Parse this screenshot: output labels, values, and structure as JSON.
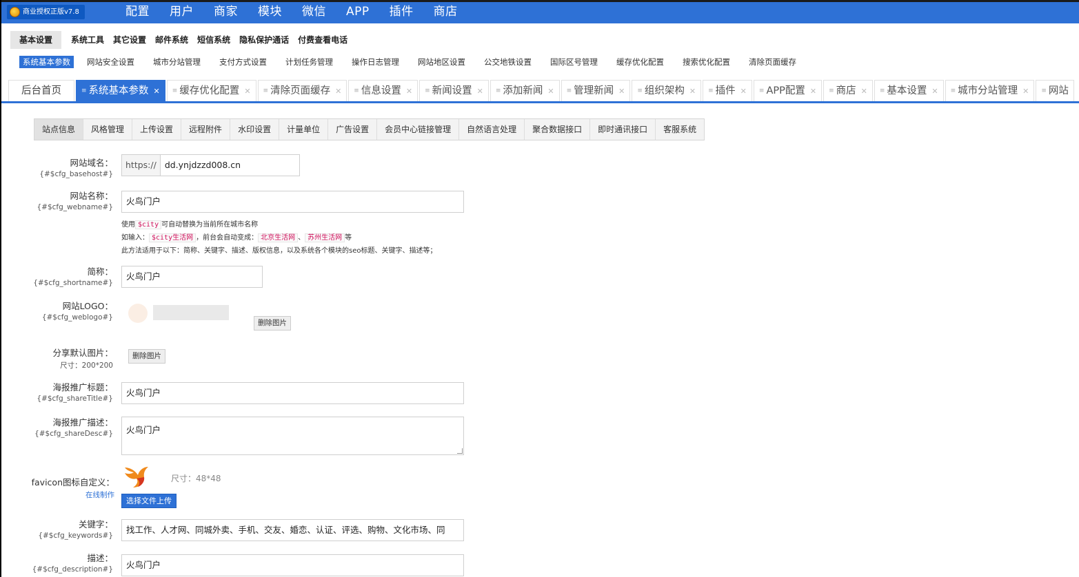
{
  "brand": {
    "label": "商业授权正版v7.8"
  },
  "topnav": [
    "配置",
    "用户",
    "商家",
    "模块",
    "微信",
    "APP",
    "插件",
    "商店"
  ],
  "menu2": [
    "基本设置",
    "系统工具",
    "其它设置",
    "邮件系统",
    "短信系统",
    "隐私保护通话",
    "付费查看电话"
  ],
  "menu3": [
    "系统基本参数",
    "网站安全设置",
    "城市分站管理",
    "支付方式设置",
    "计划任务管理",
    "操作日志管理",
    "网站地区设置",
    "公交地铁设置",
    "国际区号管理",
    "缓存优化配置",
    "搜索优化配置",
    "清除页面缓存"
  ],
  "tabs": {
    "home": "后台首页",
    "items": [
      "系统基本参数",
      "缓存优化配置",
      "清除页面缓存",
      "信息设置",
      "新闻设置",
      "添加新闻",
      "管理新闻",
      "组织架构",
      "插件",
      "APP配置",
      "商店",
      "基本设置",
      "城市分站管理",
      "网站"
    ]
  },
  "innertabs": [
    "站点信息",
    "风格管理",
    "上传设置",
    "远程附件",
    "水印设置",
    "计量单位",
    "广告设置",
    "会员中心链接管理",
    "自然语言处理",
    "聚合数据接口",
    "即时通讯接口",
    "客服系统"
  ],
  "form": {
    "domain": {
      "label": "网站域名：",
      "var": "{#$cfg_basehost#}",
      "prefix": "https://",
      "value": "dd.ynjdzzd008.cn"
    },
    "webname": {
      "label": "网站名称：",
      "var": "{#$cfg_webname#}",
      "value": "火鸟门户"
    },
    "hint": {
      "l1_a": "使用",
      "l1_code": "$city",
      "l1_b": "可自动替换为当前所在城市名称",
      "l2_a": "如输入：",
      "l2_code1": "$city生活网",
      "l2_b": "，前台会自动变成：",
      "l2_code2": "北京生活网",
      "l2_c": "、",
      "l2_code3": "苏州生活网",
      "l2_d": "等",
      "l3": "此方法适用于以下：简称、关键字、描述、版权信息，以及系统各个模块的seo标题、关键字、描述等；"
    },
    "shortname": {
      "label": "简称：",
      "var": "{#$cfg_shortname#}",
      "value": "火鸟门户"
    },
    "weblogo": {
      "label": "网站LOGO：",
      "var": "{#$cfg_weblogo#}",
      "delete": "删除图片"
    },
    "share": {
      "label": "分享默认图片：",
      "sub": "尺寸：200*200",
      "delete": "删除图片"
    },
    "shareTitle": {
      "label": "海报推广标题：",
      "var": "{#$cfg_shareTitle#}",
      "value": "火鸟门户"
    },
    "shareDesc": {
      "label": "海报推广描述：",
      "var": "{#$cfg_shareDesc#}",
      "value": "火鸟门户"
    },
    "favicon": {
      "label": "favicon图标自定义：",
      "link": "在线制作",
      "size": "尺寸：48*48",
      "upload": "选择文件上传"
    },
    "keywords": {
      "label": "关键字：",
      "var": "{#$cfg_keywords#}",
      "value": "找工作、人才网、同城外卖、手机、交友、婚恋、认证、评选、购物、文化市场、同"
    },
    "description": {
      "label": "描述：",
      "var": "{#$cfg_description#}",
      "value": "火鸟门户"
    }
  },
  "colors": {
    "primary": "#2e71d6",
    "code": "#d0125c"
  }
}
